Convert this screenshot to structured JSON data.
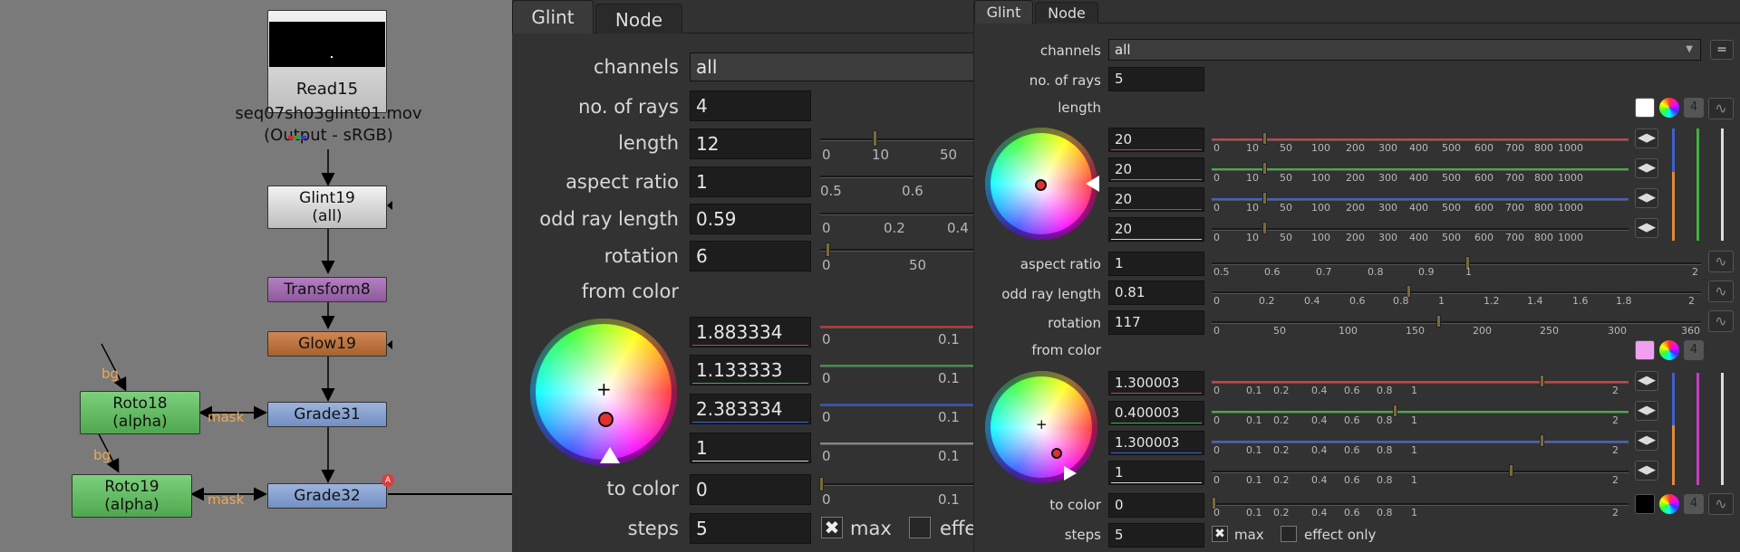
{
  "graph": {
    "read": {
      "name": "Read15",
      "file": "seq07sh03glint01.mov",
      "colorspace": "(Output - sRGB)"
    },
    "glint": {
      "name": "Glint19",
      "sub": "(all)"
    },
    "transform": {
      "name": "Transform8"
    },
    "glow": {
      "name": "Glow19"
    },
    "grade31": {
      "name": "Grade31"
    },
    "grade32": {
      "name": "Grade32"
    },
    "roto18": {
      "name": "Roto18",
      "sub": "(alpha)"
    },
    "roto19": {
      "name": "Roto19",
      "sub": "(alpha)"
    },
    "labels": {
      "bg": "bg",
      "mask": "mask"
    }
  },
  "left_panel": {
    "tabs": [
      "Glint",
      "Node"
    ],
    "channels": {
      "label": "channels",
      "value": "all"
    },
    "rays": {
      "label": "no. of rays",
      "value": "4"
    },
    "length": {
      "label": "length",
      "value": "12",
      "ticks": [
        "0",
        "10",
        "50"
      ]
    },
    "aspect": {
      "label": "aspect ratio",
      "value": "1",
      "ticks": [
        "0.5",
        "0.6"
      ]
    },
    "odd": {
      "label": "odd ray length",
      "value": "0.59",
      "ticks": [
        "0",
        "0.2",
        "0.4"
      ]
    },
    "rotation": {
      "label": "rotation",
      "value": "6",
      "ticks": [
        "0",
        "50"
      ]
    },
    "from_color": {
      "label": "from color",
      "values": [
        "1.883334",
        "1.133333",
        "2.383334",
        "1"
      ],
      "ticks": [
        "0",
        "0.1"
      ]
    },
    "to_color": {
      "label": "to color",
      "value": "0",
      "ticks": [
        "0",
        "0.1"
      ]
    },
    "steps": {
      "label": "steps",
      "value": "5",
      "max": "max",
      "effect": "effe"
    }
  },
  "right_panel": {
    "tabs": [
      "Glint",
      "Node"
    ],
    "channels": {
      "label": "channels",
      "value": "all"
    },
    "rays": {
      "label": "no. of rays",
      "value": "5"
    },
    "length": {
      "label": "length",
      "values": [
        "20",
        "20",
        "20",
        "20"
      ],
      "ticks": [
        "0",
        "10",
        "50",
        "100",
        "200",
        "300",
        "400",
        "500",
        "600",
        "700",
        "800",
        "1000"
      ],
      "count": "4"
    },
    "aspect": {
      "label": "aspect ratio",
      "value": "1",
      "ticks": [
        "0.5",
        "0.6",
        "0.7",
        "0.8",
        "0.9",
        "1",
        "2"
      ]
    },
    "odd": {
      "label": "odd ray length",
      "value": "0.81",
      "ticks": [
        "0",
        "0.2",
        "0.4",
        "0.6",
        "0.8",
        "1",
        "1.2",
        "1.4",
        "1.6",
        "1.8",
        "2"
      ]
    },
    "rotation": {
      "label": "rotation",
      "value": "117",
      "ticks": [
        "0",
        "50",
        "100",
        "150",
        "200",
        "250",
        "300",
        "360"
      ]
    },
    "from_color": {
      "label": "from color",
      "values": [
        "1.300003",
        "0.400003",
        "1.300003",
        "1"
      ],
      "ticks": [
        "0",
        "0.1",
        "0.2",
        "0.4",
        "0.6",
        "0.8",
        "1",
        "2"
      ],
      "count": "4"
    },
    "to_color": {
      "label": "to color",
      "value": "0",
      "ticks": [
        "0",
        "0.1",
        "0.2",
        "0.4",
        "0.6",
        "0.8",
        "1",
        "2"
      ],
      "count": "4"
    },
    "steps": {
      "label": "steps",
      "value": "5",
      "max": "max",
      "effect": "effect only"
    }
  },
  "colors": {
    "red": "#d04040",
    "green": "#40b040",
    "blue": "#4060d0",
    "white": "#d0d0d0",
    "orange": "#e08a3a",
    "handle": "#7a6a3a"
  },
  "icons": [
    "arrow-left-right-icon",
    "color-wheel-icon",
    "curve-icon",
    "checkbox-x-icon"
  ]
}
